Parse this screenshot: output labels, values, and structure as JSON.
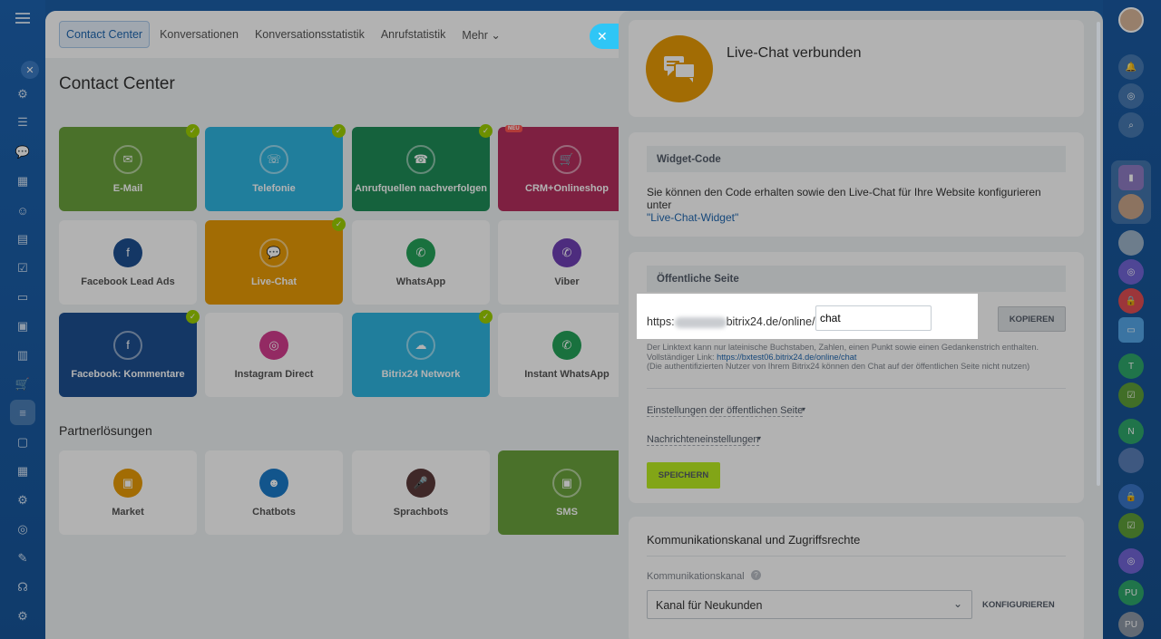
{
  "tabs": [
    "Contact Center",
    "Konversationen",
    "Konversationsstatistik",
    "Anrufstatistik",
    "Mehr ⌄"
  ],
  "page_title": "Contact Center",
  "partner_title": "Partnerlösungen",
  "badge_neu": "NEU",
  "tiles": {
    "email": "E-Mail",
    "telefonie": "Telefonie",
    "anrufquellen": "Anrufquellen nachverfolgen",
    "crm_shop": "CRM+Onlineshop",
    "fb_lead": "Facebook Lead Ads",
    "livechat": "Live-Chat",
    "whatsapp": "WhatsApp",
    "viber": "Viber",
    "fb_comments": "Facebook: Kommentare",
    "instagram": "Instagram Direct",
    "b24_network": "Bitrix24 Network",
    "instant_whatsapp": "Instant WhatsApp",
    "market": "Market",
    "chatbots": "Chatbots",
    "sprachbots": "Sprachbots",
    "sms": "SMS"
  },
  "slider": {
    "header_title": "Live-Chat verbunden",
    "widget_head": "Widget-Code",
    "widget_text": "Sie können den Code erhalten sowie den Live-Chat für Ihre Website konfigurieren unter",
    "widget_link": "\"Live-Chat-Widget\"",
    "public_head": "Öffentliche Seite",
    "url_prefix": "https:",
    "url_suffix": "bitrix24.de/online/",
    "url_input_value": "chat",
    "copy_button": "KOPIEREN",
    "hint_line1": "Der Linktext kann nur lateinische Buchstaben, Zahlen, einen Punkt sowie einen Gedankenstrich enthalten.",
    "hint_full_label": "Vollständiger Link:",
    "hint_full_link": "https://bxtest06.bitrix24.de/online/chat",
    "hint_line3": "(Die authentifizierten Nutzer von Ihrem Bitrix24 können den Chat auf der öffentlichen Seite nicht nutzen)",
    "public_settings": "Einstellungen der öffentlichen Seite",
    "message_settings": "Nachrichteneinstellungen",
    "save_button": "SPEICHERN",
    "comm_title": "Kommunikationskanal und Zugriffsrechte",
    "comm_label": "Kommunikationskanal",
    "channel_value": "Kanal für Neukunden",
    "configure_button": "KONFIGURIEREN"
  },
  "rightbar": {
    "t": "T",
    "n": "N",
    "pu1": "PU",
    "pu2": "PU"
  },
  "colors": {
    "accent_green": "#9dcf00",
    "livechat_orange": "#e89b06",
    "link_blue": "#2067b0"
  }
}
